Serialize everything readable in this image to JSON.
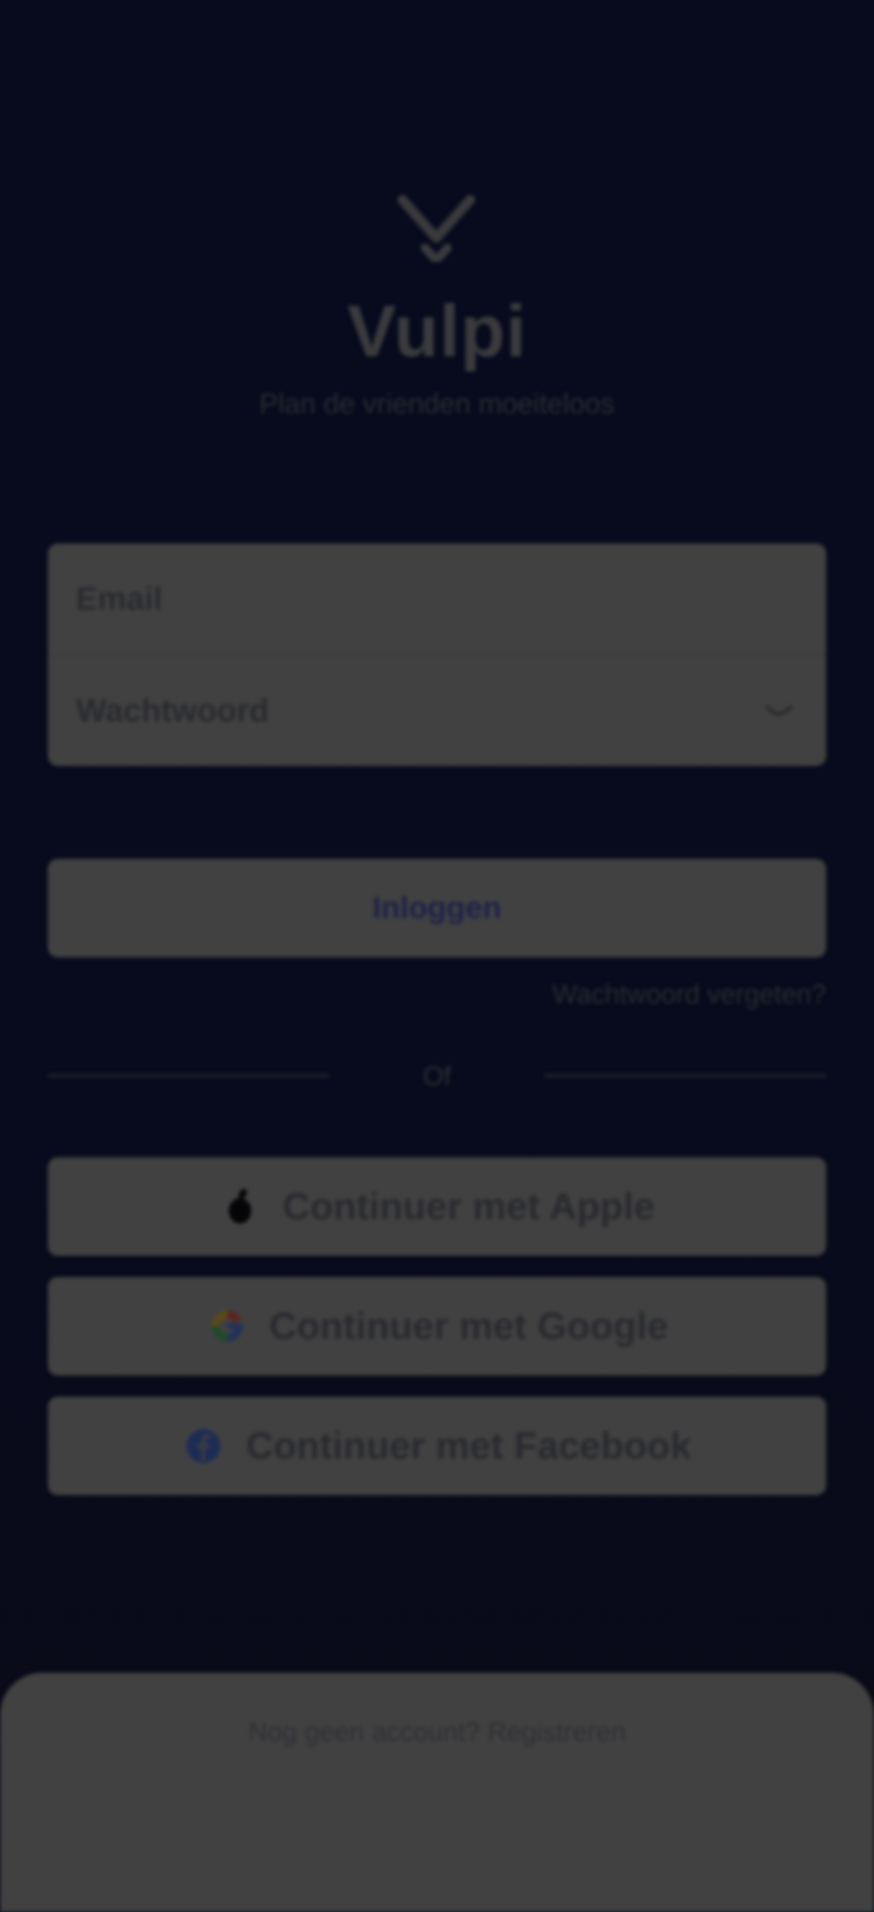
{
  "app": {
    "name": "Vulpi",
    "tagline": "Plan de vrienden moeiteloos"
  },
  "login": {
    "email_placeholder": "Email",
    "password_placeholder": "Wachtwoord",
    "login_button": "Inloggen",
    "forgot_password": "Wachtwoord vergeten?"
  },
  "divider": {
    "or_text": "Of"
  },
  "social": {
    "apple_label": "Continuer met Apple",
    "google_label": "Continuer met Google",
    "facebook_label": "Continuer met Facebook"
  },
  "signup": {
    "text": "Nog geen account? Registreren"
  },
  "icons": {
    "logo": "vulpi-logo-icon",
    "eye": "eye-icon",
    "apple": "apple-icon",
    "google": "google-icon",
    "facebook": "facebook-icon"
  }
}
